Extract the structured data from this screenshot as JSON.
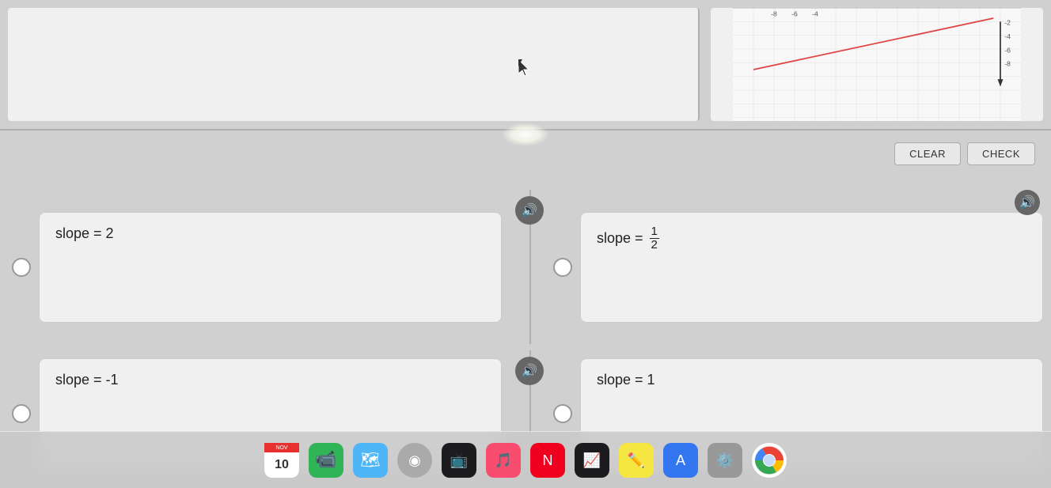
{
  "buttons": {
    "clear_label": "CLEAR",
    "check_label": "CHECK"
  },
  "cards": [
    {
      "id": "card-top-left",
      "text": "",
      "position": "top-left"
    },
    {
      "id": "card-top-right",
      "text": "",
      "position": "top-right"
    }
  ],
  "answer_options": [
    {
      "id": "option-1",
      "label": "slope = 2",
      "position": "middle-left"
    },
    {
      "id": "option-2",
      "label_prefix": "slope = ",
      "label_fraction": {
        "numerator": "1",
        "denominator": "2"
      },
      "position": "middle-right"
    },
    {
      "id": "option-3",
      "label": "slope = -1",
      "position": "bottom-left"
    },
    {
      "id": "option-4",
      "label": "slope = 1",
      "position": "bottom-right"
    }
  ],
  "chart": {
    "y_labels": [
      "-2",
      "-4",
      "-6",
      "-8"
    ],
    "x_labels": [
      "-8",
      "-6",
      "-4"
    ]
  },
  "dock": {
    "items": [
      {
        "name": "calendar",
        "color": "#e8302e"
      },
      {
        "name": "facetime",
        "color": "#2fb557"
      },
      {
        "name": "maps",
        "color": "#4eb5f7"
      },
      {
        "name": "tv",
        "color": "#1c1c1e"
      },
      {
        "name": "music",
        "color": "#f84d6e"
      },
      {
        "name": "news",
        "color": "#f0001e"
      },
      {
        "name": "stocks",
        "color": "#1c1c1e"
      },
      {
        "name": "appstore",
        "color": "#3376f0"
      },
      {
        "name": "systemprefs",
        "color": "#aaa"
      },
      {
        "name": "chrome",
        "color": "#4285f4"
      }
    ]
  }
}
